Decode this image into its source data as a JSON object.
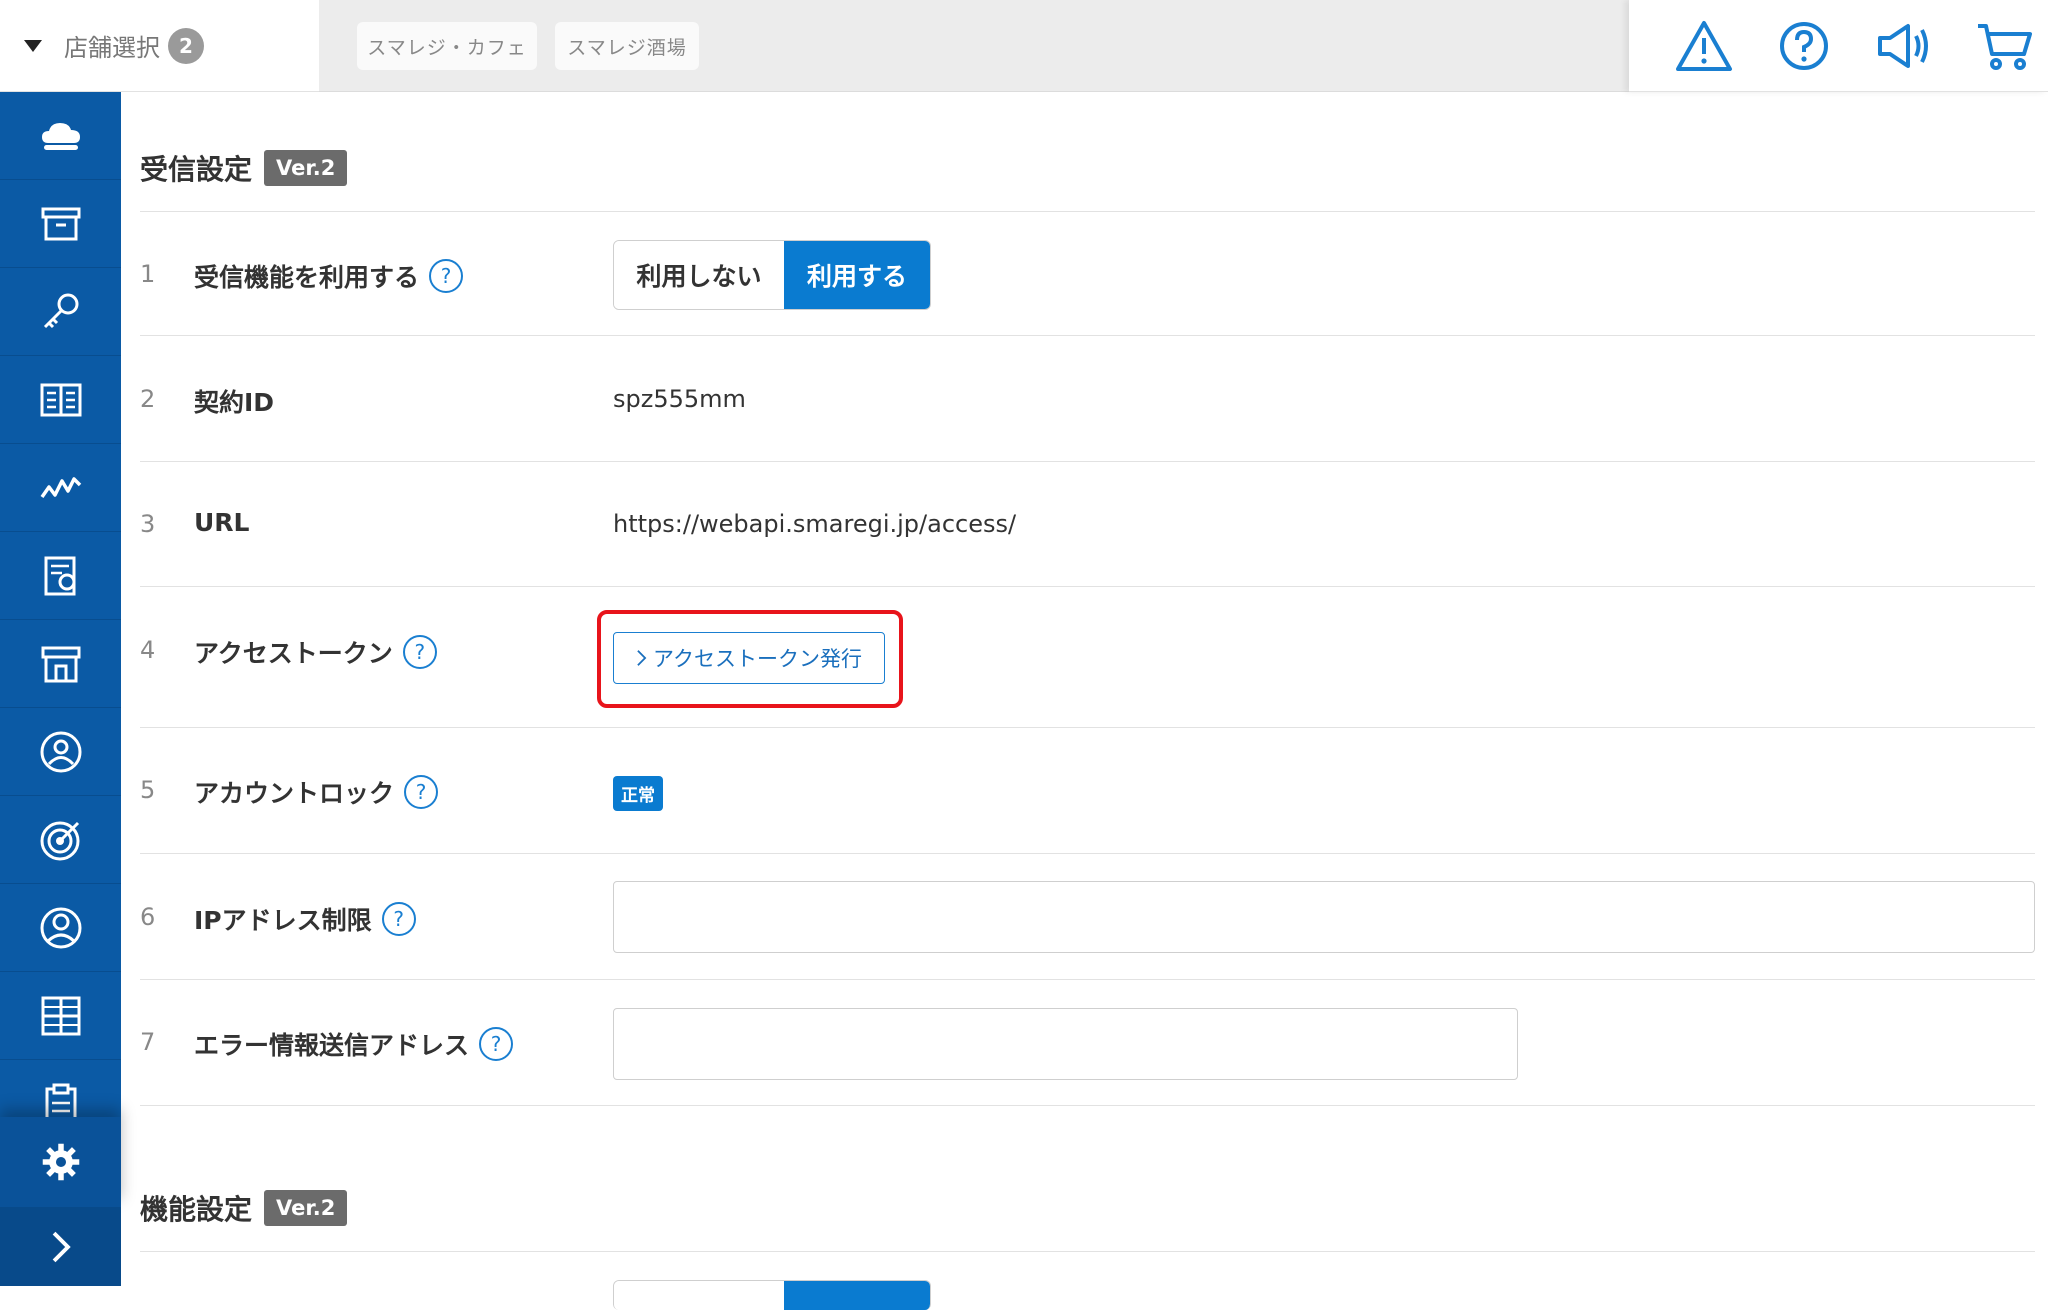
{
  "topbar": {
    "store_select_label": "店舗選択",
    "store_count": "2",
    "stores": [
      "スマレジ・カフェ",
      "スマレジ酒場"
    ],
    "icons": [
      "warning-icon",
      "help-icon",
      "megaphone-icon",
      "cart-icon"
    ]
  },
  "sidebar": {
    "items": [
      "cloud-icon",
      "archive-box-icon",
      "key-icon",
      "book-icon",
      "line-chart-icon",
      "report-icon",
      "store-icon",
      "customer-icon",
      "target-icon",
      "staff-icon",
      "grid-icon",
      "clipboard-icon"
    ],
    "settings": "gear-icon",
    "expand": "chevron-right-icon"
  },
  "section1": {
    "title": "受信設定",
    "version": "Ver.2"
  },
  "rows": [
    {
      "num": "1",
      "label": "受信機能を利用する",
      "help": "?",
      "toggle_off": "利用しない",
      "toggle_on": "利用する"
    },
    {
      "num": "2",
      "label": "契約ID",
      "value": "spz555mm"
    },
    {
      "num": "3",
      "label": "URL",
      "value": "https://webapi.smaregi.jp/access/"
    },
    {
      "num": "4",
      "label": "アクセストークン",
      "help": "?",
      "button": "アクセストークン発行"
    },
    {
      "num": "5",
      "label": "アカウントロック",
      "help": "?",
      "status": "正常"
    },
    {
      "num": "6",
      "label": "IPアドレス制限",
      "help": "?",
      "value": ""
    },
    {
      "num": "7",
      "label": "エラー情報送信アドレス",
      "help": "?",
      "value": ""
    }
  ],
  "section2": {
    "title": "機能設定",
    "version": "Ver.2"
  },
  "colors": {
    "sidebar": "#0b5aa5",
    "accent": "#0a7bd0",
    "highlight": "#e8141b"
  }
}
